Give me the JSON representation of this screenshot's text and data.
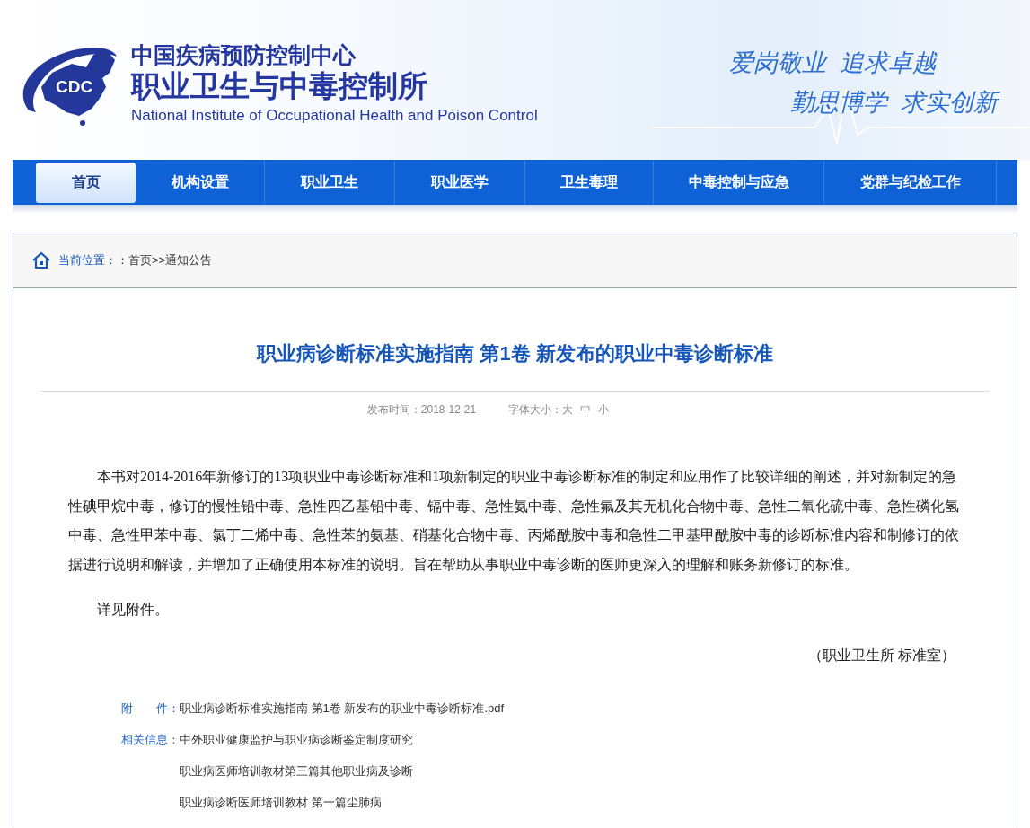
{
  "header": {
    "logo_text": "CDC",
    "org_name": "中国疾病预防控制中心",
    "institute_name": "职业卫生与中毒控制所",
    "english_name": "National Institute of Occupational Health and Poison Control",
    "mottos": [
      "爱岗敬业  追求卓越",
      "勤思博学  求实创新"
    ]
  },
  "nav": [
    {
      "label": "首页",
      "selected": true
    },
    {
      "label": "机构设置",
      "selected": false
    },
    {
      "label": "职业卫生",
      "selected": false
    },
    {
      "label": "职业医学",
      "selected": false
    },
    {
      "label": "卫生毒理",
      "selected": false
    },
    {
      "label": "中毒控制与应急",
      "selected": false
    },
    {
      "label": "党群与纪检工作",
      "selected": false
    }
  ],
  "breadcrumb": {
    "label": "当前位置：",
    "path": "：首页>>通知公告"
  },
  "article": {
    "title": "职业病诊断标准实施指南 第1卷 新发布的职业中毒诊断标准",
    "date": "发布时间：2018-12-21",
    "font_size_label": "字体大小：",
    "font_sizes": [
      "大",
      "中",
      "小"
    ],
    "paragraphs": [
      "本书对2014-2016年新修订的13项职业中毒诊断标准和1项新制定的职业中毒诊断标准的制定和应用作了比较详细的阐述，并对新制定的急性碘甲烷中毒，修订的慢性铅中毒、急性四乙基铅中毒、镉中毒、急性氨中毒、急性氟及其无机化合物中毒、急性二氧化硫中毒、急性磷化氢中毒、急性甲苯中毒、氯丁二烯中毒、急性苯的氨基、硝基化合物中毒、丙烯酰胺中毒和急性二甲基甲酰胺中毒的诊断标准内容和制修订的依据进行说明和解读，并增加了正确使用本标准的说明。旨在帮助从事职业中毒诊断的医师更深入的理解和账务新修订的标准。",
      "详见附件。"
    ],
    "signature": "（职业卫生所 标准室）",
    "attachment": {
      "label": "附　　件：",
      "link": "职业病诊断标准实施指南 第1卷 新发布的职业中毒诊断标准.pdf"
    },
    "related": {
      "label": "相关信息：",
      "links": [
        "中外职业健康监护与职业病诊断鉴定制度研究",
        "职业病医师培训教材第三篇其他职业病及诊断",
        "职业病诊断医师培训教材 第一篇尘肺病"
      ]
    }
  }
}
